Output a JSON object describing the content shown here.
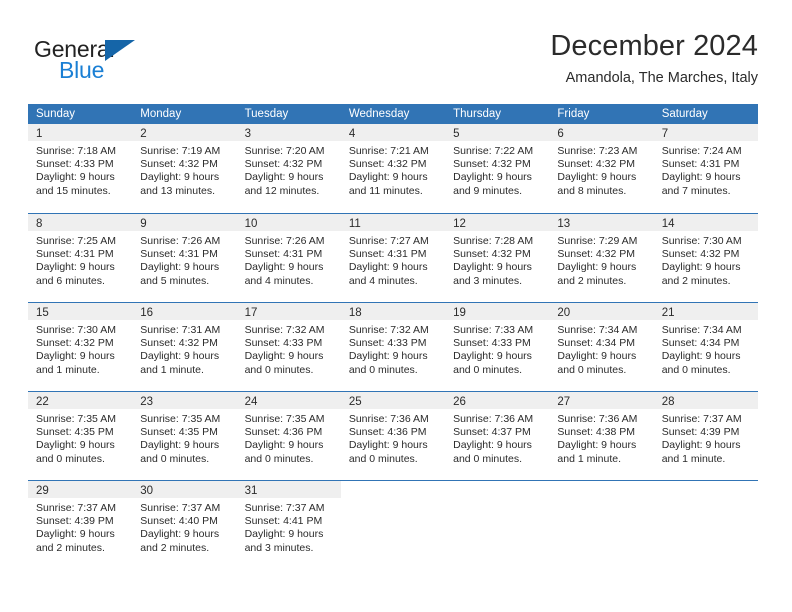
{
  "brand": {
    "name_top": "General",
    "name_bottom": "Blue",
    "flag_icon": "triangle-flag-icon",
    "accent_color": "#1a7fd4"
  },
  "header": {
    "title": "December 2024",
    "subtitle": "Amandola, The Marches, Italy"
  },
  "calendar": {
    "header_color": "#3174b5",
    "day_band_color": "#efefef",
    "day_names": [
      "Sunday",
      "Monday",
      "Tuesday",
      "Wednesday",
      "Thursday",
      "Friday",
      "Saturday"
    ],
    "weeks": [
      [
        {
          "day": "1",
          "sunrise": "Sunrise: 7:18 AM",
          "sunset": "Sunset: 4:33 PM",
          "daylight1": "Daylight: 9 hours",
          "daylight2": "and 15 minutes."
        },
        {
          "day": "2",
          "sunrise": "Sunrise: 7:19 AM",
          "sunset": "Sunset: 4:32 PM",
          "daylight1": "Daylight: 9 hours",
          "daylight2": "and 13 minutes."
        },
        {
          "day": "3",
          "sunrise": "Sunrise: 7:20 AM",
          "sunset": "Sunset: 4:32 PM",
          "daylight1": "Daylight: 9 hours",
          "daylight2": "and 12 minutes."
        },
        {
          "day": "4",
          "sunrise": "Sunrise: 7:21 AM",
          "sunset": "Sunset: 4:32 PM",
          "daylight1": "Daylight: 9 hours",
          "daylight2": "and 11 minutes."
        },
        {
          "day": "5",
          "sunrise": "Sunrise: 7:22 AM",
          "sunset": "Sunset: 4:32 PM",
          "daylight1": "Daylight: 9 hours",
          "daylight2": "and 9 minutes."
        },
        {
          "day": "6",
          "sunrise": "Sunrise: 7:23 AM",
          "sunset": "Sunset: 4:32 PM",
          "daylight1": "Daylight: 9 hours",
          "daylight2": "and 8 minutes."
        },
        {
          "day": "7",
          "sunrise": "Sunrise: 7:24 AM",
          "sunset": "Sunset: 4:31 PM",
          "daylight1": "Daylight: 9 hours",
          "daylight2": "and 7 minutes."
        }
      ],
      [
        {
          "day": "8",
          "sunrise": "Sunrise: 7:25 AM",
          "sunset": "Sunset: 4:31 PM",
          "daylight1": "Daylight: 9 hours",
          "daylight2": "and 6 minutes."
        },
        {
          "day": "9",
          "sunrise": "Sunrise: 7:26 AM",
          "sunset": "Sunset: 4:31 PM",
          "daylight1": "Daylight: 9 hours",
          "daylight2": "and 5 minutes."
        },
        {
          "day": "10",
          "sunrise": "Sunrise: 7:26 AM",
          "sunset": "Sunset: 4:31 PM",
          "daylight1": "Daylight: 9 hours",
          "daylight2": "and 4 minutes."
        },
        {
          "day": "11",
          "sunrise": "Sunrise: 7:27 AM",
          "sunset": "Sunset: 4:31 PM",
          "daylight1": "Daylight: 9 hours",
          "daylight2": "and 4 minutes."
        },
        {
          "day": "12",
          "sunrise": "Sunrise: 7:28 AM",
          "sunset": "Sunset: 4:32 PM",
          "daylight1": "Daylight: 9 hours",
          "daylight2": "and 3 minutes."
        },
        {
          "day": "13",
          "sunrise": "Sunrise: 7:29 AM",
          "sunset": "Sunset: 4:32 PM",
          "daylight1": "Daylight: 9 hours",
          "daylight2": "and 2 minutes."
        },
        {
          "day": "14",
          "sunrise": "Sunrise: 7:30 AM",
          "sunset": "Sunset: 4:32 PM",
          "daylight1": "Daylight: 9 hours",
          "daylight2": "and 2 minutes."
        }
      ],
      [
        {
          "day": "15",
          "sunrise": "Sunrise: 7:30 AM",
          "sunset": "Sunset: 4:32 PM",
          "daylight1": "Daylight: 9 hours",
          "daylight2": "and 1 minute."
        },
        {
          "day": "16",
          "sunrise": "Sunrise: 7:31 AM",
          "sunset": "Sunset: 4:32 PM",
          "daylight1": "Daylight: 9 hours",
          "daylight2": "and 1 minute."
        },
        {
          "day": "17",
          "sunrise": "Sunrise: 7:32 AM",
          "sunset": "Sunset: 4:33 PM",
          "daylight1": "Daylight: 9 hours",
          "daylight2": "and 0 minutes."
        },
        {
          "day": "18",
          "sunrise": "Sunrise: 7:32 AM",
          "sunset": "Sunset: 4:33 PM",
          "daylight1": "Daylight: 9 hours",
          "daylight2": "and 0 minutes."
        },
        {
          "day": "19",
          "sunrise": "Sunrise: 7:33 AM",
          "sunset": "Sunset: 4:33 PM",
          "daylight1": "Daylight: 9 hours",
          "daylight2": "and 0 minutes."
        },
        {
          "day": "20",
          "sunrise": "Sunrise: 7:34 AM",
          "sunset": "Sunset: 4:34 PM",
          "daylight1": "Daylight: 9 hours",
          "daylight2": "and 0 minutes."
        },
        {
          "day": "21",
          "sunrise": "Sunrise: 7:34 AM",
          "sunset": "Sunset: 4:34 PM",
          "daylight1": "Daylight: 9 hours",
          "daylight2": "and 0 minutes."
        }
      ],
      [
        {
          "day": "22",
          "sunrise": "Sunrise: 7:35 AM",
          "sunset": "Sunset: 4:35 PM",
          "daylight1": "Daylight: 9 hours",
          "daylight2": "and 0 minutes."
        },
        {
          "day": "23",
          "sunrise": "Sunrise: 7:35 AM",
          "sunset": "Sunset: 4:35 PM",
          "daylight1": "Daylight: 9 hours",
          "daylight2": "and 0 minutes."
        },
        {
          "day": "24",
          "sunrise": "Sunrise: 7:35 AM",
          "sunset": "Sunset: 4:36 PM",
          "daylight1": "Daylight: 9 hours",
          "daylight2": "and 0 minutes."
        },
        {
          "day": "25",
          "sunrise": "Sunrise: 7:36 AM",
          "sunset": "Sunset: 4:36 PM",
          "daylight1": "Daylight: 9 hours",
          "daylight2": "and 0 minutes."
        },
        {
          "day": "26",
          "sunrise": "Sunrise: 7:36 AM",
          "sunset": "Sunset: 4:37 PM",
          "daylight1": "Daylight: 9 hours",
          "daylight2": "and 0 minutes."
        },
        {
          "day": "27",
          "sunrise": "Sunrise: 7:36 AM",
          "sunset": "Sunset: 4:38 PM",
          "daylight1": "Daylight: 9 hours",
          "daylight2": "and 1 minute."
        },
        {
          "day": "28",
          "sunrise": "Sunrise: 7:37 AM",
          "sunset": "Sunset: 4:39 PM",
          "daylight1": "Daylight: 9 hours",
          "daylight2": "and 1 minute."
        }
      ],
      [
        {
          "day": "29",
          "sunrise": "Sunrise: 7:37 AM",
          "sunset": "Sunset: 4:39 PM",
          "daylight1": "Daylight: 9 hours",
          "daylight2": "and 2 minutes."
        },
        {
          "day": "30",
          "sunrise": "Sunrise: 7:37 AM",
          "sunset": "Sunset: 4:40 PM",
          "daylight1": "Daylight: 9 hours",
          "daylight2": "and 2 minutes."
        },
        {
          "day": "31",
          "sunrise": "Sunrise: 7:37 AM",
          "sunset": "Sunset: 4:41 PM",
          "daylight1": "Daylight: 9 hours",
          "daylight2": "and 3 minutes."
        },
        {
          "day": "",
          "sunrise": "",
          "sunset": "",
          "daylight1": "",
          "daylight2": ""
        },
        {
          "day": "",
          "sunrise": "",
          "sunset": "",
          "daylight1": "",
          "daylight2": ""
        },
        {
          "day": "",
          "sunrise": "",
          "sunset": "",
          "daylight1": "",
          "daylight2": ""
        },
        {
          "day": "",
          "sunrise": "",
          "sunset": "",
          "daylight1": "",
          "daylight2": ""
        }
      ]
    ]
  }
}
